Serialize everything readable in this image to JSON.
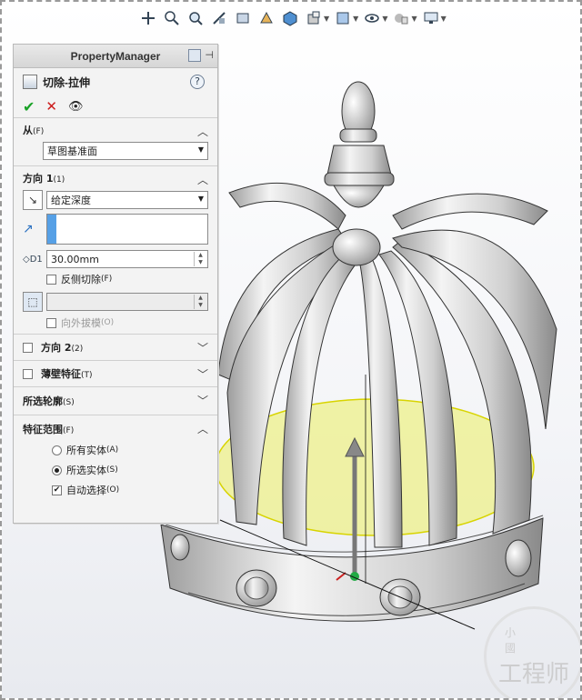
{
  "toolbar": {
    "icons": [
      "zoom-fit-icon",
      "zoom-area-icon",
      "zoom-prev-icon",
      "section-view-icon",
      "view-orientation-icon",
      "display-style-icon",
      "hide-show-icon",
      "edit-appearance-icon",
      "scene-icon",
      "view-settings-icon"
    ]
  },
  "property_manager": {
    "header_title": "PropertyManager",
    "feature_title": "切除-拉伸",
    "help_symbol": "?",
    "ok_symbol": "✔",
    "cancel_symbol": "✕",
    "from": {
      "title": "从",
      "key": "(F)",
      "value": "草图基准面"
    },
    "direction1": {
      "title": "方向 1",
      "key": "(1)",
      "end_condition": "给定深度",
      "depth": "30.00mm",
      "flip_side": "反侧切除",
      "flip_side_key": "(F)",
      "draft_outward": "向外拔模",
      "draft_outward_key": "(O)"
    },
    "direction2": {
      "title": "方向 2",
      "key": "(2)"
    },
    "thin_feature": {
      "title": "薄壁特征",
      "key": "(T)"
    },
    "selected_contours": {
      "title": "所选轮廓",
      "key": "(S)"
    },
    "feature_scope": {
      "title": "特征范围",
      "key": "(F)",
      "all_bodies": "所有实体",
      "all_bodies_key": "(A)",
      "selected_bodies": "所选实体",
      "selected_bodies_key": "(S)",
      "auto_select": "自动选择",
      "auto_select_key": "(O)"
    }
  },
  "watermark": {
    "top": "小 國",
    "main": "工程师"
  },
  "colors": {
    "accent": "#56a0e6",
    "ok": "#1aa228",
    "cancel": "#cc1c1c",
    "sketch_plane": "#eef08a"
  }
}
